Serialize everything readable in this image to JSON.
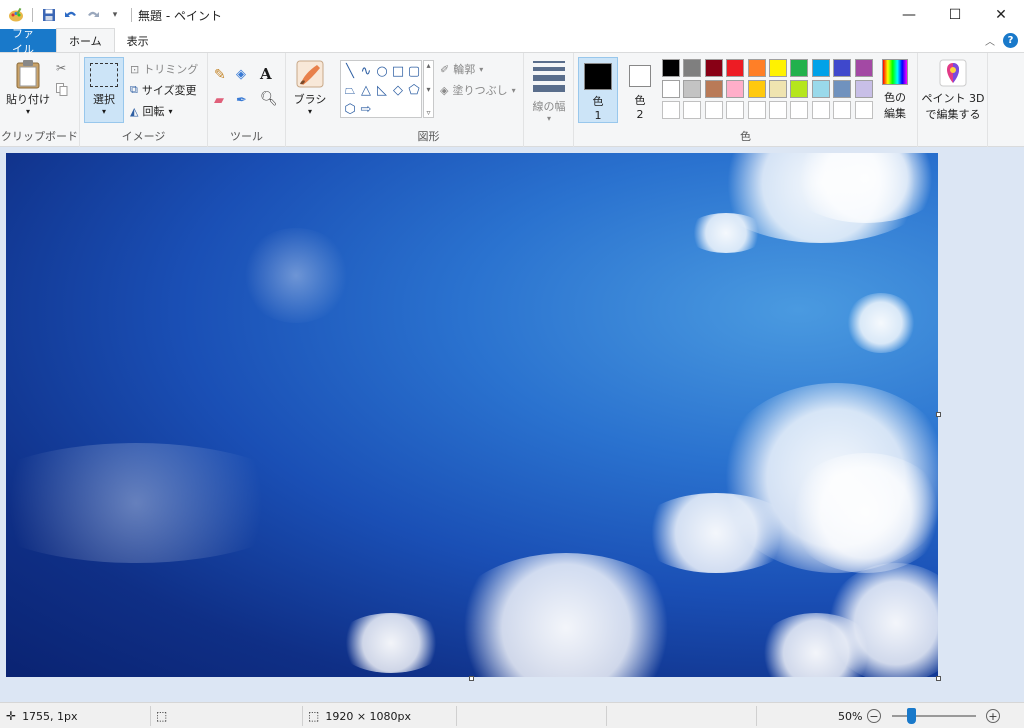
{
  "app": {
    "title": "無題 - ペイント"
  },
  "window_controls": {
    "minimize": "—",
    "maximize": "☐",
    "close": "✕"
  },
  "tabs": [
    {
      "label": "ファイル"
    },
    {
      "label": "ホーム"
    },
    {
      "label": "表示"
    }
  ],
  "ribbon": {
    "clipboard": {
      "paste_label": "貼り付け",
      "group_label": "クリップボード"
    },
    "image": {
      "select_label": "選択",
      "crop_label": "トリミング",
      "resize_label": "サイズ変更",
      "rotate_label": "回転",
      "group_label": "イメージ"
    },
    "tools": {
      "group_label": "ツール"
    },
    "brushes": {
      "label": "ブラシ"
    },
    "shapes": {
      "outline_label": "輪郭",
      "fill_label": "塗りつぶし",
      "group_label": "図形"
    },
    "size": {
      "label": "線の幅"
    },
    "colors": {
      "color1_label": "色",
      "color1_num": "1",
      "color2_label": "色",
      "color2_num": "2",
      "edit_label_1": "色の",
      "edit_label_2": "編集",
      "group_label": "色",
      "color1_value": "#000000",
      "color2_value": "#ffffff",
      "palette_row1": [
        "#000000",
        "#7f7f7f",
        "#880015",
        "#ed1c24",
        "#ff7f27",
        "#fff200",
        "#22b14c",
        "#00a2e8",
        "#3f48cc",
        "#a349a4"
      ],
      "palette_row2": [
        "#ffffff",
        "#c3c3c3",
        "#b97a57",
        "#ffaec9",
        "#ffc90e",
        "#efe4b0",
        "#b5e61d",
        "#99d9ea",
        "#7092be",
        "#c8bfe7"
      ],
      "palette_row3": [
        "#ffffff",
        "#ffffff",
        "#ffffff",
        "#ffffff",
        "#ffffff",
        "#ffffff",
        "#ffffff",
        "#ffffff",
        "#ffffff",
        "#ffffff"
      ]
    },
    "paint3d": {
      "label_1": "ペイント 3D",
      "label_2": "で編集する"
    }
  },
  "status": {
    "cursor_pos": "1755, 1px",
    "image_size": "1920 × 1080px",
    "zoom": "50%",
    "zoom_level_fraction": 0.5
  }
}
